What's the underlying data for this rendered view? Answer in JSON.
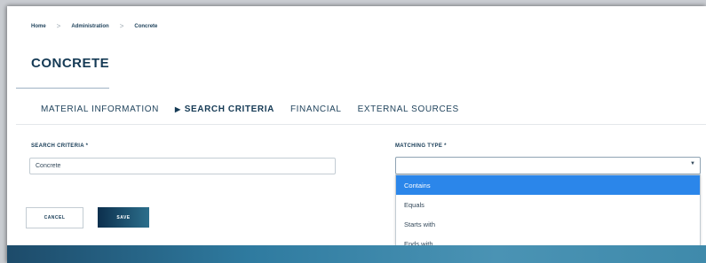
{
  "breadcrumb": {
    "items": [
      "Home",
      "Administration",
      "Concrete"
    ],
    "separator": ">"
  },
  "page": {
    "title": "CONCRETE"
  },
  "tabs": [
    {
      "label": "MATERIAL INFORMATION",
      "active": false
    },
    {
      "label": "SEARCH CRITERIA",
      "active": true
    },
    {
      "label": "FINANCIAL",
      "active": false
    },
    {
      "label": "EXTERNAL SOURCES",
      "active": false
    }
  ],
  "tab_active_marker": "▶",
  "form": {
    "search_criteria": {
      "label": "SEARCH CRITERIA *",
      "value": "Concrete"
    },
    "matching_type": {
      "label": "MATCHING TYPE *",
      "value": "",
      "caret": "▼",
      "options": [
        "Contains",
        "Equals",
        "Starts with",
        "Ends with"
      ],
      "highlighted_option": "Contains"
    }
  },
  "buttons": {
    "cancel_label": "CANCEL",
    "save_label": "SAVE"
  },
  "colors": {
    "accent_blue": "#2b86ea",
    "title_navy": "#153a55",
    "save_dark": "#0c2f4d",
    "footer_blue": "#2f7ba0"
  }
}
